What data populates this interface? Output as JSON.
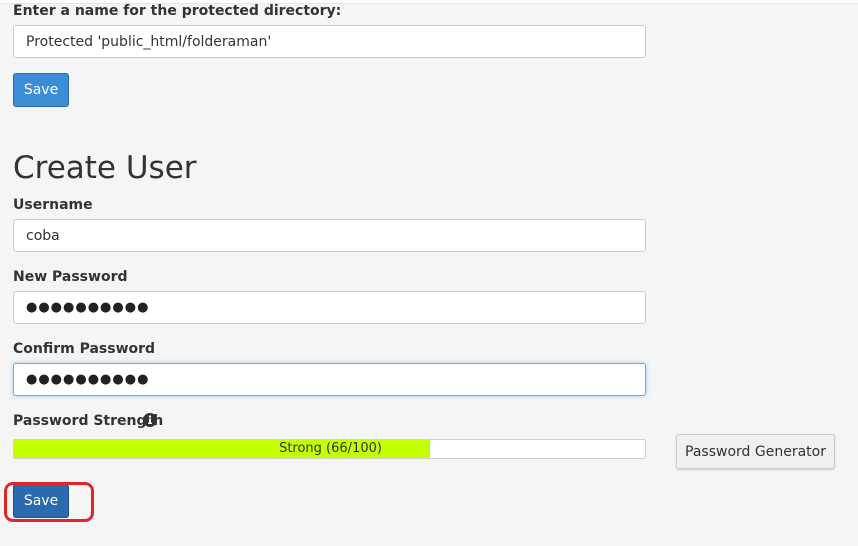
{
  "directory": {
    "name_label": "Enter a name for the protected directory:",
    "name_value": "Protected 'public_html/folderaman'",
    "save_label": "Save"
  },
  "create_user": {
    "heading": "Create User",
    "username_label": "Username",
    "username_value": "coba",
    "new_password_label": "New Password",
    "new_password_mask": "●●●●●●●●●●",
    "confirm_password_label": "Confirm Password",
    "confirm_password_mask": "●●●●●●●●●●",
    "strength_label": "Password Strength",
    "strength_text": "Strong (66/100)",
    "strength_score": 66,
    "strength_max": 100,
    "strength_color": "#c3ff00",
    "generator_label": "Password Generator",
    "save_label": "Save",
    "info_icon": "info-circle-icon"
  },
  "colors": {
    "primary_button": "#3b8dd8",
    "highlight": "#e0252b"
  }
}
